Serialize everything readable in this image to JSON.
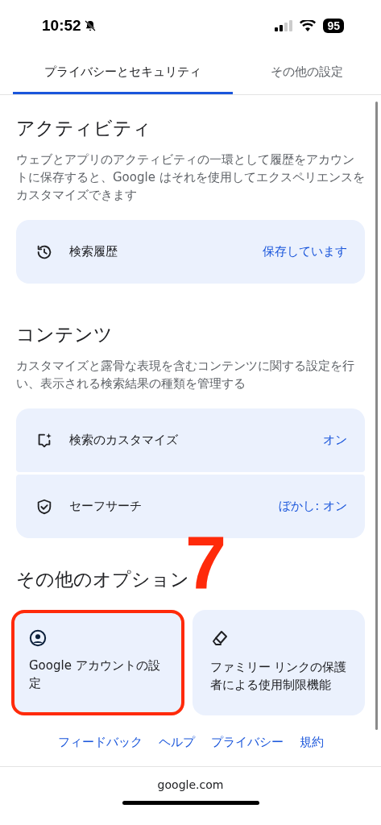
{
  "status_bar": {
    "time": "10:52",
    "silent": true,
    "battery": "95"
  },
  "tabs": [
    {
      "label": "プライバシーとセキュリティ",
      "selected": true
    },
    {
      "label": "その他の設定",
      "selected": false
    }
  ],
  "sections": [
    {
      "title": "アクティビティ",
      "description": "ウェブとアプリのアクティビティの一環として履歴をアカウントに保存すると、Google はそれを使用してエクスペリエンスをカスタマイズできます",
      "settings": [
        {
          "kind": "history",
          "label": "検索履歴",
          "value": "保存しています"
        }
      ]
    },
    {
      "title": "コンテンツ",
      "description": "カスタマイズと露骨な表現を含むコンテンツに関する設定を行い、表示される検索結果の種類を管理する",
      "settings": [
        {
          "kind": "sparkle",
          "label": "検索のカスタマイズ",
          "value": "オン"
        },
        {
          "kind": "shield",
          "label": "セーフサーチ",
          "value": "ぼかし: オン"
        }
      ]
    }
  ],
  "options": {
    "title": "その他のオプション",
    "step_number": "7",
    "cards": [
      {
        "kind": "account",
        "label": "Google アカウントの設定",
        "highlighted": true
      },
      {
        "kind": "eraser",
        "label": "ファミリー リンクの保護者による使用制限機能",
        "highlighted": false
      }
    ]
  },
  "footer_links": [
    "フィードバック",
    "ヘルプ",
    "プライバシー",
    "規約"
  ],
  "address_bar": {
    "url": "google.com"
  }
}
